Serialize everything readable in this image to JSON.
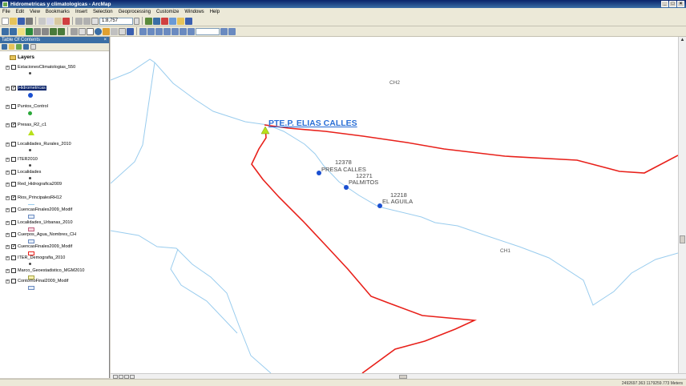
{
  "window": {
    "title": "Hidrometricas y climatologicas - ArcMap",
    "controls": [
      "_",
      "□",
      "×"
    ]
  },
  "menu": [
    "File",
    "Edit",
    "View",
    "Bookmarks",
    "Insert",
    "Selection",
    "Geoprocessing",
    "Customize",
    "Windows",
    "Help"
  ],
  "toolbar": {
    "scale_value": "1:8,757"
  },
  "toc": {
    "title": "Table Of Contents",
    "root_label": "Layers",
    "layers": [
      {
        "label": "EstacionesClimatologias_550",
        "checked": false,
        "selected": false,
        "symbol": "small-dot"
      },
      {
        "label": "Hidrometricas",
        "checked": true,
        "selected": true,
        "symbol": "blue-dot"
      },
      {
        "label": "Puntos_Control",
        "checked": false,
        "selected": false,
        "symbol": "green-dot"
      },
      {
        "label": "Presas_R2_c1",
        "checked": true,
        "selected": false,
        "symbol": "green-triangle"
      },
      {
        "label": "Localidades_Rurales_2010",
        "checked": false,
        "selected": false,
        "symbol": "small-dot"
      },
      {
        "label": "ITER2010",
        "checked": false,
        "selected": false,
        "symbol": "small-dot"
      },
      {
        "label": "Localidades",
        "checked": false,
        "selected": false,
        "symbol": "small-dot"
      },
      {
        "label": "Red_Hidrografica2009",
        "checked": false,
        "selected": false,
        "symbol": "none"
      },
      {
        "label": "Rios_PrincipalesRH12",
        "checked": true,
        "selected": false,
        "symbol": "line"
      },
      {
        "label": "CuencasFinales2009_Modif",
        "checked": false,
        "selected": false,
        "symbol": "box"
      },
      {
        "label": "Localidades_Urbanas_2010",
        "checked": false,
        "selected": false,
        "symbol": "pink-box"
      },
      {
        "label": "Cuerpos_Agua_Nombres_CH",
        "checked": false,
        "selected": false,
        "symbol": "box"
      },
      {
        "label": "CuencasFinales2009_Modif",
        "checked": true,
        "selected": false,
        "symbol": "red-box"
      },
      {
        "label": "ITER_Demografia_2010",
        "checked": false,
        "selected": false,
        "symbol": "small-dot"
      },
      {
        "label": "Marco_Geoestadistico_MGM2010",
        "checked": false,
        "selected": false,
        "symbol": "yellow-box"
      },
      {
        "label": "ContornoFinal2009_Modif",
        "checked": false,
        "selected": false,
        "symbol": "box"
      }
    ]
  },
  "map": {
    "dam_label": "PTE.P. ELIAS CALLES",
    "basin_labels": [
      "CH2",
      "CH1"
    ],
    "stations": [
      {
        "id": "12378",
        "name": "PRESA CALLES"
      },
      {
        "id": "12271",
        "name": "PALMITOS"
      },
      {
        "id": "12218",
        "name": "EL AGUILA"
      }
    ],
    "colors": {
      "river": "#99ccee",
      "basin": "#e8201a",
      "station": "#1a4fd1",
      "dam": "#b8e01a",
      "dam_label": "#2a6fd6"
    }
  },
  "status": {
    "coordinates": "2492697.363  1179259.773 Meters"
  }
}
